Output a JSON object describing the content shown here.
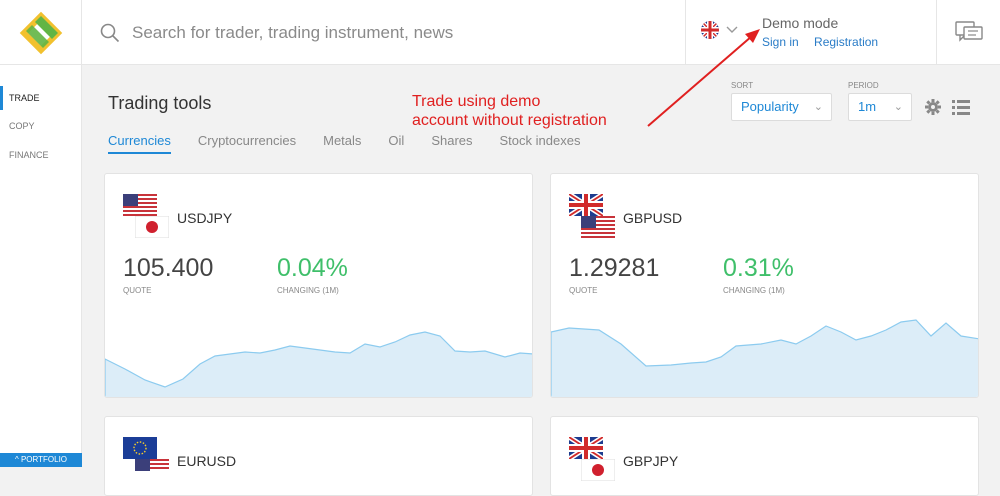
{
  "header": {
    "search_placeholder": "Search for trader, trading instrument, news",
    "demo_title": "Demo mode",
    "sign_in": "Sign in",
    "registration": "Registration"
  },
  "sidebar": {
    "items": [
      {
        "label": "TRADE",
        "active": true
      },
      {
        "label": "COPY",
        "active": false
      },
      {
        "label": "FINANCE",
        "active": false
      }
    ],
    "portfolio": "^ PORTFOLIO"
  },
  "main": {
    "title": "Trading tools",
    "tabs": [
      "Currencies",
      "Cryptocurrencies",
      "Metals",
      "Oil",
      "Shares",
      "Stock indexes"
    ],
    "sort_label": "SORT",
    "sort_value": "Popularity",
    "period_label": "PERIOD",
    "period_value": "1m"
  },
  "annotation": {
    "line1": "Trade using demo",
    "line2": "account without registration"
  },
  "cards": [
    {
      "pair": "USDJPY",
      "quote": "105.400",
      "quote_label": "QUOTE",
      "change": "0.04%",
      "change_label": "CHANGING (1M)",
      "flags": [
        "us-flag",
        "jp-flag"
      ]
    },
    {
      "pair": "GBPUSD",
      "quote": "1.29281",
      "quote_label": "QUOTE",
      "change": "0.31%",
      "change_label": "CHANGING (1M)",
      "flags": [
        "uk-flag",
        "us-flag"
      ]
    },
    {
      "pair": "EURUSD",
      "flags": [
        "eu-flag",
        "us-flag"
      ]
    },
    {
      "pair": "GBPJPY",
      "flags": [
        "uk-flag",
        "jp-flag"
      ]
    }
  ],
  "colors": {
    "accent": "#1e88d6",
    "positive": "#3fbf6a",
    "annotation": "#e02020",
    "spark_fill": "#d8ecf8",
    "spark_line": "#8ccbef"
  }
}
